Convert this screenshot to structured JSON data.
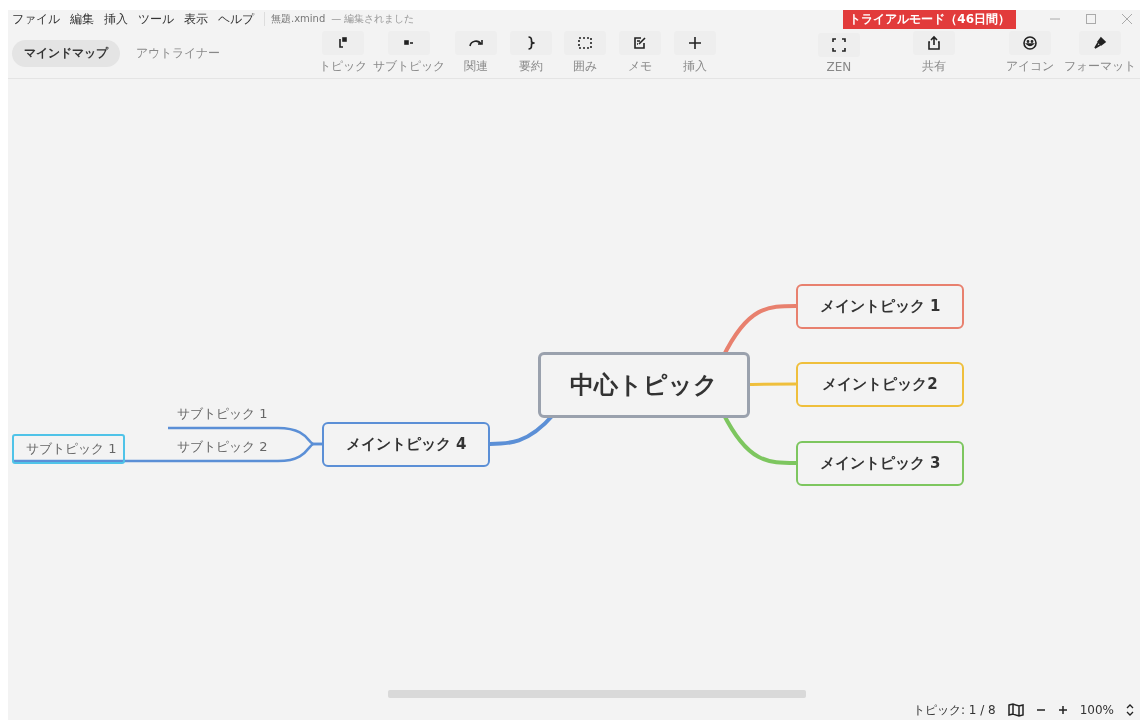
{
  "menu": [
    "ファイル",
    "編集",
    "挿入",
    "ツール",
    "表示",
    "ヘルプ"
  ],
  "document": {
    "title": "無題.xmind",
    "status": "— 編集されました"
  },
  "trial_badge": "トライアルモード（46日間）",
  "view_tabs": [
    {
      "label": "マインドマップ",
      "selected": true
    },
    {
      "label": "アウトライナー",
      "selected": false
    }
  ],
  "toolbar": [
    {
      "kind": "topic",
      "label": "トピック"
    },
    {
      "kind": "subtopic",
      "label": "サブトピック"
    },
    {
      "kind": "relation",
      "label": "関連"
    },
    {
      "kind": "summary",
      "label": "要約"
    },
    {
      "kind": "boundary",
      "label": "囲み"
    },
    {
      "kind": "note",
      "label": "メモ"
    },
    {
      "kind": "insert",
      "label": "挿入"
    },
    {
      "kind": "zen",
      "label": "ZEN"
    },
    {
      "kind": "share",
      "label": "共有"
    }
  ],
  "side_tools": [
    {
      "kind": "icon",
      "label": "アイコン"
    },
    {
      "kind": "format",
      "label": "フォーマット"
    }
  ],
  "map": {
    "central": "中心トピック",
    "main_topics": [
      {
        "label": "メイントピック 1",
        "color": "#e8806e"
      },
      {
        "label": "メイントピック2",
        "color": "#efbf3c"
      },
      {
        "label": "メイントピック 3",
        "color": "#7dc65f"
      },
      {
        "label": "メイントピック 4",
        "color": "#5b8fd6",
        "children": [
          {
            "label": "サブトピック 1",
            "selected": false
          },
          {
            "label": "サブトピック 2",
            "selected": false,
            "children": [
              {
                "label": "サブトピック 1",
                "selected": true
              }
            ]
          }
        ]
      }
    ]
  },
  "status_bar": {
    "topic_count": "トピック: 1 / 8",
    "zoom": "100%"
  }
}
